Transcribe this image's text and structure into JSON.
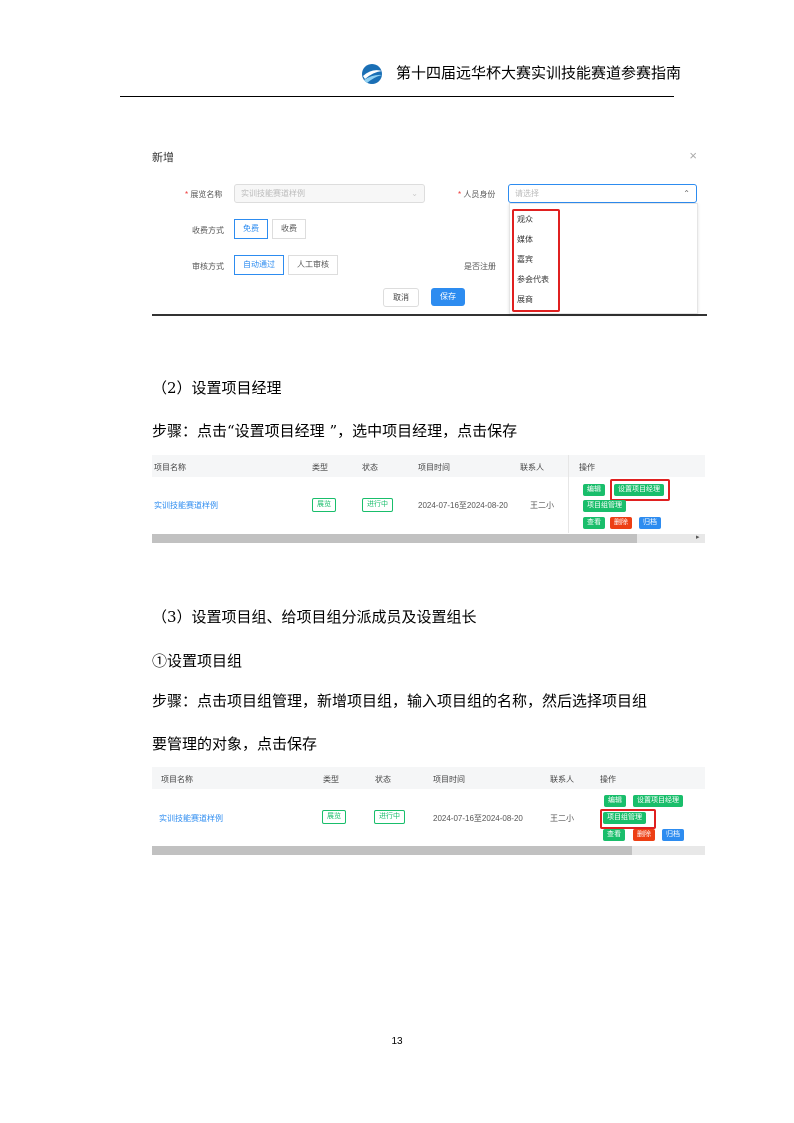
{
  "header": {
    "title": "第十四届远华杯大赛实训技能赛道参赛指南",
    "logo_icon": "globe-swoosh-icon"
  },
  "dialog": {
    "title": "新增",
    "close_glyph": "×",
    "exhibition_name_label": "展览名称",
    "exhibition_name_value": "实训技能赛道样例",
    "identity_label": "人员身份",
    "identity_placeholder": "请选择",
    "fee_label": "收费方式",
    "fee_options": [
      "免费",
      "收费"
    ],
    "review_label": "审核方式",
    "review_options": [
      "自动通过",
      "人工审核"
    ],
    "register_label": "是否注册",
    "identity_options": [
      "观众",
      "媒体",
      "嘉宾",
      "参会代表",
      "展商"
    ],
    "cancel_label": "取消",
    "save_label": "保存"
  },
  "section2": {
    "heading": "（2）设置项目经理",
    "steps": "步骤：点击“设置项目经理 ”，选中项目经理，点击保存"
  },
  "table1": {
    "columns": [
      "项目名称",
      "类型",
      "状态",
      "项目时间",
      "联系人",
      "操作"
    ],
    "row": {
      "name": "实训技能赛道样例",
      "type": "展览",
      "status": "进行中",
      "time": "2024-07-16至2024-08-20",
      "contact": "王二小"
    },
    "actions": [
      "编辑",
      "设置项目经理",
      "项目组管理",
      "查看",
      "删除",
      "归档"
    ]
  },
  "section3": {
    "heading": "（3）设置项目组、给项目组分派成员及设置组长",
    "sub": "①设置项目组",
    "steps_line1": "步骤：点击项目组管理，新增项目组，输入项目组的名称，然后选择项目组",
    "steps_line2": "要管理的对象，点击保存"
  },
  "table2": {
    "columns": [
      "项目名称",
      "类型",
      "状态",
      "项目时间",
      "联系人",
      "操作"
    ],
    "row": {
      "name": "实训技能赛道样例",
      "type": "展览",
      "status": "进行中",
      "time": "2024-07-16至2024-08-20",
      "contact": "王二小"
    },
    "actions": [
      "编辑",
      "设置项目经理",
      "项目组管理",
      "查看",
      "删除",
      "归档"
    ]
  },
  "page_number": "13"
}
